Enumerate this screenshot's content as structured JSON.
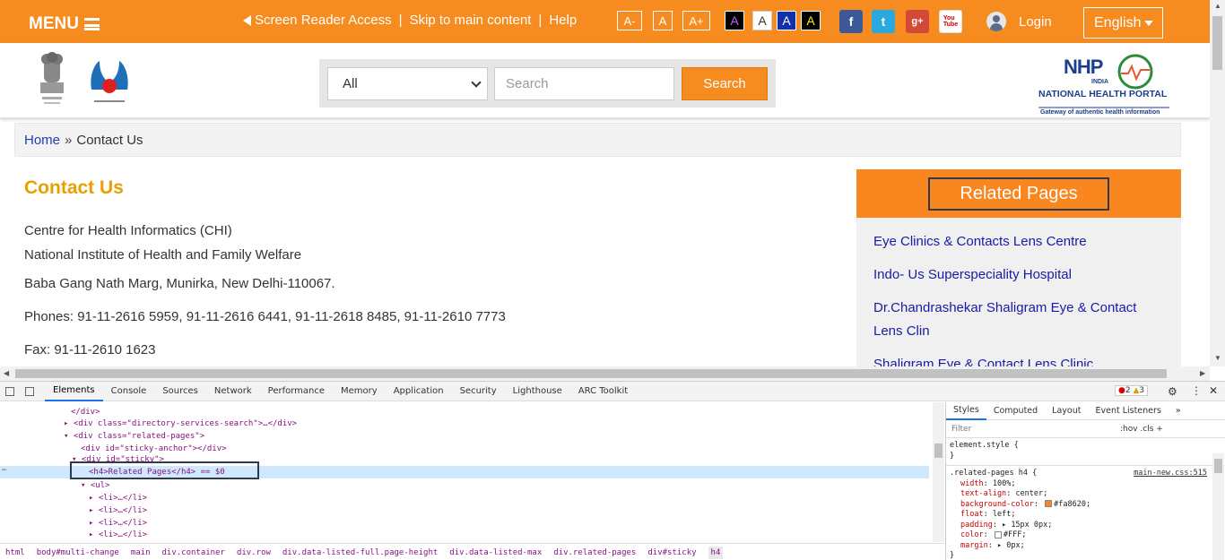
{
  "colors": {
    "accent": "#f68b1f",
    "related_bg": "#fa8620",
    "link": "#1a3fb5",
    "title": "#e8a000"
  },
  "topbar": {
    "menu": "MENU",
    "screen_reader": "Screen Reader Access",
    "skip": "Skip to main content",
    "help": "Help",
    "sep": "|",
    "font_sizes": [
      "A-",
      "A",
      "A+"
    ],
    "contrast": [
      "A",
      "A",
      "A",
      "A"
    ],
    "social": [
      "facebook-icon",
      "twitter-icon",
      "google-plus-icon",
      "youtube-icon"
    ],
    "login": "Login",
    "language": "English"
  },
  "header": {
    "search_category": "All",
    "search_placeholder": "Search",
    "search_button": "Search",
    "nhp": {
      "name": "NHP",
      "country": "INDIA",
      "portal": "NATIONAL HEALTH PORTAL",
      "tagline": "Gateway of authentic health information"
    }
  },
  "breadcrumb": {
    "home": "Home",
    "sep": "»",
    "current": "Contact Us"
  },
  "content": {
    "title": "Contact Us",
    "org": "Centre for Health Informatics (CHI)",
    "inst": "National Institute of Health and Family Welfare",
    "address": "Baba Gang Nath Marg, Munirka, New Delhi-110067.",
    "phones": "Phones: 91-11-2616 5959, 91-11-2616 6441, 91-11-2618 8485, 91-11-2610 7773",
    "fax": "Fax: 91-11-2610 1623"
  },
  "related": {
    "heading": "Related Pages",
    "items": [
      "Eye Clinics & Contacts Lens Centre",
      "Indo- Us Superspeciality Hospital",
      "Dr.Chandrashekar Shaligram Eye & Contact Lens Clin",
      "Shaligram Eye & Contact Lens Clinic"
    ]
  },
  "devtools": {
    "tabs": [
      "Elements",
      "Console",
      "Sources",
      "Network",
      "Performance",
      "Memory",
      "Application",
      "Security",
      "Lighthouse",
      "ARC Toolkit"
    ],
    "errors": "2",
    "warnings": "3",
    "dom_lines": [
      "</div>",
      "<div class=\"directory-services-search\">…</div>",
      "<div class=\"related-pages\">",
      "<div id=\"sticky-anchor\"></div>",
      "<div id=\"sticky\">",
      "<h4>Related Pages</h4> == $0",
      "<ul>",
      "<li>…</li>",
      "<li>…</li>",
      "<li>…</li>",
      "<li>…</li>"
    ],
    "crumbs": [
      "html",
      "body#multi-change",
      "main",
      "div.container",
      "div.row",
      "div.data-listed-full.page-height",
      "div.data-listed-max",
      "div.related-pages",
      "div#sticky",
      "h4"
    ],
    "style_tabs": [
      "Styles",
      "Computed",
      "Layout",
      "Event Listeners",
      "»"
    ],
    "filter_placeholder": "Filter",
    "filter_tools": ":hov  .cls  +",
    "element_style": "element.style {",
    "close_brace": "}",
    "rule_selector": ".related-pages h4 {",
    "rule_source": "main-new.css:515",
    "rule_props": [
      {
        "name": "width",
        "value": "100%;"
      },
      {
        "name": "text-align",
        "value": "center;"
      },
      {
        "name": "background-color",
        "value": "#fa8620;"
      },
      {
        "name": "float",
        "value": "left;"
      },
      {
        "name": "padding",
        "value": "▸ 15px 0px;"
      },
      {
        "name": "color",
        "value": "#FFF;"
      },
      {
        "name": "margin",
        "value": "▸ 0px;"
      }
    ]
  }
}
